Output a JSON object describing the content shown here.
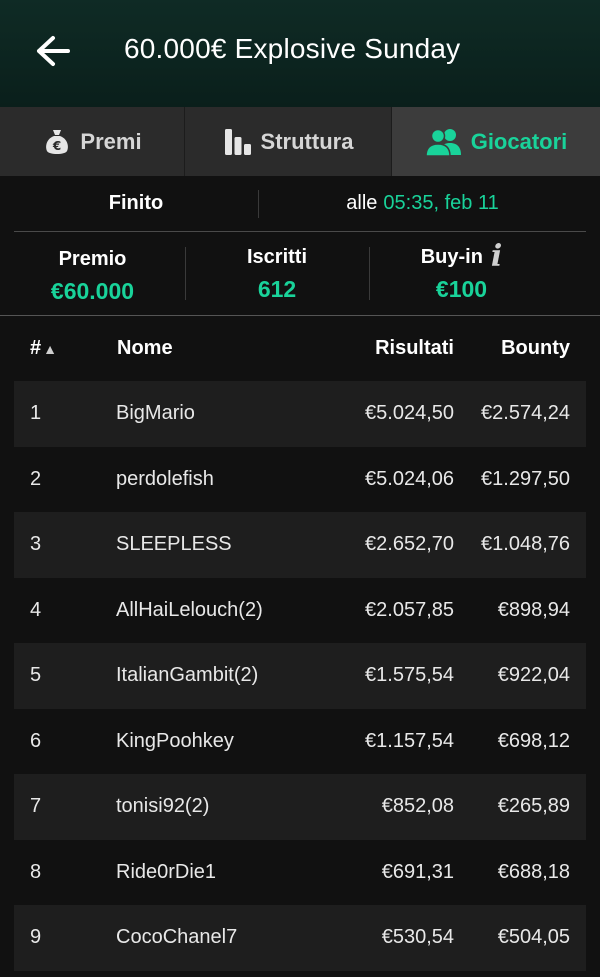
{
  "header": {
    "title": "60.000€ Explosive Sunday",
    "back_icon": "arrow-left-icon"
  },
  "tabs": [
    {
      "label": "Premi",
      "icon": "money-bag-icon",
      "active": false
    },
    {
      "label": "Struttura",
      "icon": "bar-chart-icon",
      "active": false
    },
    {
      "label": "Giocatori",
      "icon": "players-icon",
      "active": true
    }
  ],
  "status": {
    "state": "Finito",
    "prefix": "alle",
    "time": "05:35, feb 11"
  },
  "stats": {
    "prize_label": "Premio",
    "prize_value": "€60.000",
    "entrants_label": "Iscritti",
    "entrants_value": "612",
    "buyin_label": "Buy-in",
    "buyin_value": "€100",
    "info_icon": "info-icon"
  },
  "table": {
    "headers": {
      "rank": "#",
      "rank_sort": "▲",
      "name": "Nome",
      "results": "Risultati",
      "bounty": "Bounty"
    },
    "rows": [
      {
        "rank": "1",
        "name": "BigMario",
        "results": "€5.024,50",
        "bounty": "€2.574,24"
      },
      {
        "rank": "2",
        "name": "perdolefish",
        "results": "€5.024,06",
        "bounty": "€1.297,50"
      },
      {
        "rank": "3",
        "name": "SLEEPLESS",
        "results": "€2.652,70",
        "bounty": "€1.048,76"
      },
      {
        "rank": "4",
        "name": "AllHaiLelouch(2)",
        "results": "€2.057,85",
        "bounty": "€898,94"
      },
      {
        "rank": "5",
        "name": "ItalianGambit(2)",
        "results": "€1.575,54",
        "bounty": "€922,04"
      },
      {
        "rank": "6",
        "name": "KingPoohkey",
        "results": "€1.157,54",
        "bounty": "€698,12"
      },
      {
        "rank": "7",
        "name": "tonisi92(2)",
        "results": "€852,08",
        "bounty": "€265,89"
      },
      {
        "rank": "8",
        "name": "Ride0rDie1",
        "results": "€691,31",
        "bounty": "€688,18"
      },
      {
        "rank": "9",
        "name": "CocoChanel7",
        "results": "€530,54",
        "bounty": "€504,05"
      }
    ]
  },
  "colors": {
    "accent": "#19d39a",
    "background": "#111111",
    "row_alt": "#1e1e1e",
    "header_bg": "#0f2b25"
  }
}
